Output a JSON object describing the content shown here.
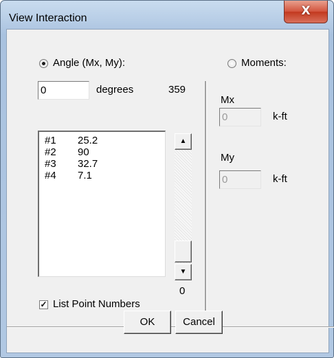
{
  "window": {
    "title": "View Interaction",
    "close_glyph": "X"
  },
  "angle": {
    "radio_label": "Angle (Mx, My):",
    "selected": true,
    "degrees_value": "0",
    "degrees_label": "degrees",
    "max_label": "359",
    "min_label": "0"
  },
  "points": [
    {
      "id": "#1",
      "value": "25.2"
    },
    {
      "id": "#2",
      "value": "90"
    },
    {
      "id": "#3",
      "value": "32.7"
    },
    {
      "id": "#4",
      "value": "7.1"
    }
  ],
  "scrollbar": {
    "up_glyph": "▲",
    "down_glyph": "▼",
    "position_fraction": 0.0
  },
  "list_point_numbers": {
    "label": "List Point Numbers",
    "checked": true
  },
  "moments": {
    "radio_label": "Moments:",
    "selected": false,
    "mx_label": "Mx",
    "mx_value": "0",
    "mx_unit": "k-ft",
    "my_label": "My",
    "my_value": "0",
    "my_unit": "k-ft"
  },
  "buttons": {
    "ok": "OK",
    "cancel": "Cancel"
  }
}
